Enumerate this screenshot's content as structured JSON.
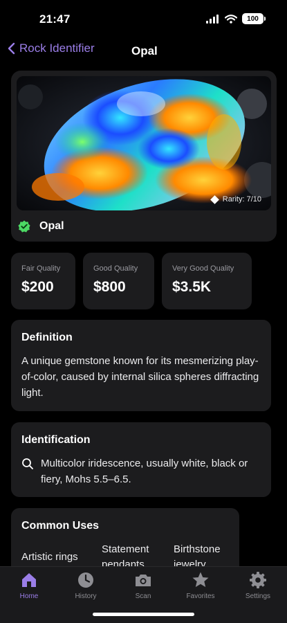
{
  "status_bar": {
    "time": "21:47",
    "battery": "100"
  },
  "nav": {
    "back_label": "Rock Identifier",
    "title": "Opal"
  },
  "hero": {
    "rarity": "Rarity: 7/10",
    "name": "Opal",
    "check_color": "#4cd964"
  },
  "prices": [
    {
      "label": "Fair Quality",
      "value": "$200"
    },
    {
      "label": "Good Quality",
      "value": "$800"
    },
    {
      "label": "Very Good Quality",
      "value": "$3.5K"
    }
  ],
  "definition": {
    "title": "Definition",
    "text": "A unique gemstone known for its mesmerizing play-of-color, caused by internal silica spheres diffracting light."
  },
  "identification": {
    "title": "Identification",
    "icon": "search-icon",
    "text": "Multicolor iridescence, usually white, black or fiery, Mohs 5.5–6.5."
  },
  "common_uses": {
    "title": "Common Uses",
    "items": [
      "Artistic rings",
      "Statement pendants",
      "Birthstone jewelry"
    ]
  },
  "tabs": [
    {
      "label": "Home",
      "icon": "house-icon",
      "active": true
    },
    {
      "label": "History",
      "icon": "clock-icon",
      "active": false
    },
    {
      "label": "Scan",
      "icon": "camera-icon",
      "active": false
    },
    {
      "label": "Favorites",
      "icon": "star-icon",
      "active": false
    },
    {
      "label": "Settings",
      "icon": "gear-icon",
      "active": false
    }
  ],
  "colors": {
    "accent": "#9b7ee8",
    "card": "#1c1c1e",
    "background": "#000000",
    "muted": "#8e8e93"
  }
}
